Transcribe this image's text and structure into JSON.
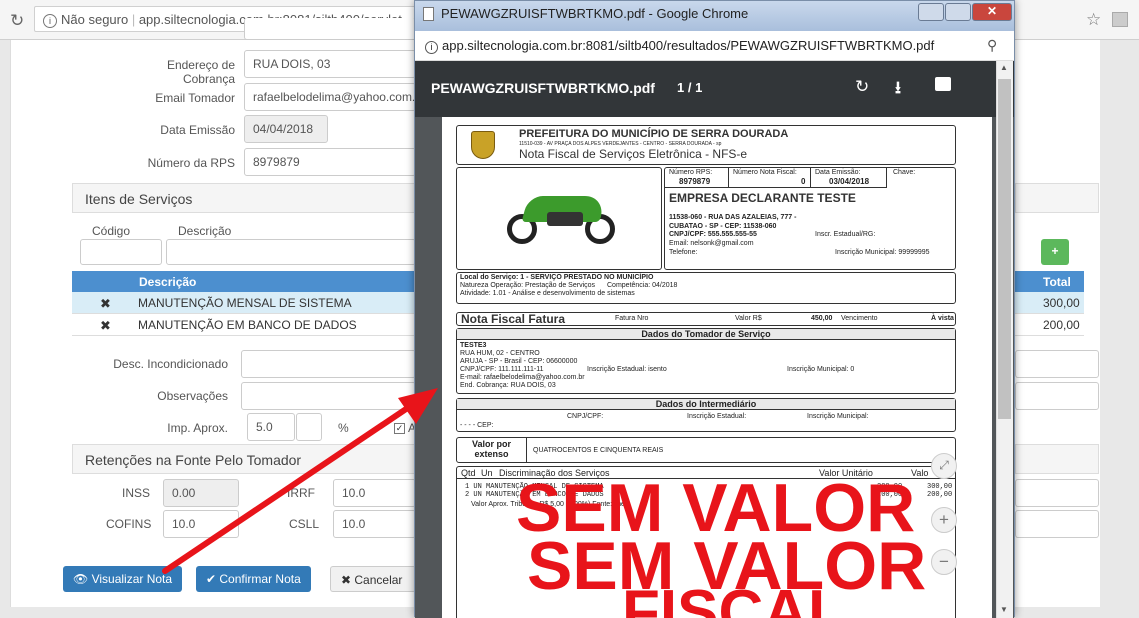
{
  "browser": {
    "security": "Não seguro",
    "url": "app.siltecnologia.com.br:8081/siltb400/servlet"
  },
  "form": {
    "address_label": "Endereço de Cobrança",
    "address_value": "RUA DOIS, 03",
    "email_label": "Email Tomador",
    "email_value": "rafaelbelodelima@yahoo.com.br",
    "date_label": "Data Emissão",
    "date_value": "04/04/2018",
    "rps_label": "Número da RPS",
    "rps_value": "8979879"
  },
  "services": {
    "title": "Itens de Serviços",
    "code_label": "Código",
    "desc_label": "Descrição",
    "add_label": "+",
    "table_header": "Descrição",
    "total_header": "Total",
    "rows": [
      {
        "remove": "✖",
        "desc": "MANUTENÇÃO MENSAL DE SISTEMA",
        "total": "300,00"
      },
      {
        "remove": "✖",
        "desc": "MANUTENÇÃO EM BANCO DE DADOS",
        "total": "200,00"
      }
    ]
  },
  "extra": {
    "discount_label": "Desc. Incondicionado",
    "obs_label": "Observações",
    "approx_label": "Imp. Aprox.",
    "approx_value": "5.0",
    "percent": "%",
    "check_label": "A"
  },
  "retention": {
    "title": "Retenções na Fonte Pelo Tomador",
    "inss_label": "INSS",
    "inss_value": "0.00",
    "irrf_label": "IRRF",
    "irrf_value": "10.0",
    "cofins_label": "COFINS",
    "cofins_value": "10.0",
    "csll_label": "CSLL",
    "csll_value": "10.0"
  },
  "actions": {
    "view": "Visualizar Nota",
    "confirm": "Confirmar Nota",
    "cancel": "Cancelar"
  },
  "pdf_window": {
    "title": "PEWAWGZRUISFTWBRTKMO.pdf - Google Chrome",
    "url": "app.siltecnologia.com.br:8081/siltb400/resultados/PEWAWGZRUISFTWBRTKMO.pdf",
    "filename": "PEWAWGZRUISFTWBRTKMO.pdf",
    "pages": "1 / 1"
  },
  "nfse": {
    "city": "PREFEITURA DO MUNICÍPIO DE SERRA DOURADA",
    "city_addr": "11510-039 - AV PRAÇA DOS ALPES VERDEJANTES - CENTRO - SERRA DOURADA - sp",
    "doc_title": "Nota Fiscal de Serviços Eletrônica - NFS-e",
    "rps_label": "Número RPS:",
    "rps_value": "8979879",
    "nf_label": "Número Nota Fiscal:",
    "nf_value": "0",
    "emis_label": "Data Emissão:",
    "emis_value": "03/04/2018",
    "key_label": "Chave:",
    "company": "EMPRESA DECLARANTE TESTE",
    "c_line1": "11538-060 - RUA DAS AZALEIAS, 777 -",
    "c_line2": "CUBATAO - SP - CEP: 11538-060",
    "c_line3": "CNPJ/CPF: 555.555.555-55",
    "c_ie": "Inscr. Estadual/RG:",
    "c_email": "Email:  nelsonk@gmail.com",
    "c_phone": "Telefone:",
    "c_im": "Inscrição Municipal: 99999995",
    "local": "Local do Serviço: 1 - SERVIÇO PRESTADO NO MUNICÍPIO",
    "natureza": "Natureza Operação: Prestação de Serviços",
    "competencia": "Competência: 04/2018",
    "atividade": "Atividade: 1.01 - Análise e desenvolvimento de sistemas",
    "fatura_title": "Nota Fiscal Fatura",
    "fatura_nro": "Fatura Nro",
    "valor_label": "Valor R$",
    "valor": "450,00",
    "venc": "Vencimento",
    "vista": "À vista",
    "tomador_title": "Dados do Tomador de Serviço",
    "t_name": "TESTE3",
    "t_addr": "RUA HUM, 02 - CENTRO",
    "t_city": "ARUJA - SP - Brasil - CEP: 06600000",
    "t_cnpj": "CNPJ/CPF: 111.111.111-11",
    "t_ie": "Inscrição Estadual:  isento",
    "t_im": "Inscrição Municipal:  0",
    "t_email": "E-mail: rafaelbelodelima@yahoo.com.br",
    "t_cob": "End. Cobrança: RUA DOIS, 03",
    "inter_title": "Dados do Intermediário",
    "i_cnpj": "CNPJ/CPF:",
    "i_ie": "Inscrição Estadual:",
    "i_im": "Inscrição Municipal:",
    "i_cep": "- - - - CEP:",
    "extenso_label1": "Valor por",
    "extenso_label2": "extenso",
    "extenso": "QUATROCENTOS E CINQUENTA REAIS",
    "disc_qtd": "Qtd",
    "disc_un": "Un",
    "disc_title": "Discriminação dos Serviços",
    "disc_unit": "Valor Unitário",
    "disc_total": "Valo",
    "disc_row1": "1    UN MANUTENÇÃO MENSAL DE SISTEMA",
    "disc_row1_v": "300,00",
    "disc_row1_t": "300,00",
    "disc_row2": "2    UN MANUTENÇÃO EM BANCO DE DADOS",
    "disc_row2_v": "200,00",
    "disc_row2_t": "200,00",
    "tributos": "Valor Aprox. Tributos: R$ 5,00 (1,00%) Fonte:sine",
    "wm1": "SEM VALOR",
    "wm2": "SEM VALOR",
    "wm3": "FISCAL"
  },
  "colors": {
    "accent": "#4c8fcf",
    "watermark": "#e8141a",
    "arrow": "#e8141a",
    "add": "#5cb85c",
    "pdf_toolbar": "#323639"
  }
}
